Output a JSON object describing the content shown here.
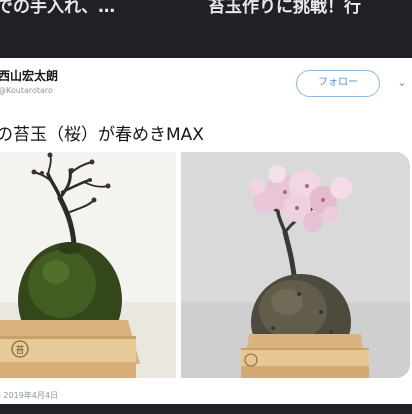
{
  "top_titles": {
    "left": "での手入れ、…",
    "right": "苔玉作りに挑戦！行"
  },
  "tweet": {
    "user_name": "西山宏太朗",
    "handle": "@Koutarotaro",
    "follow_label": "フォロー",
    "text": "の苔玉（桜）が春めきMAX",
    "date": "- 2019年4月4日"
  },
  "icons": {
    "menu": "chevron-down-icon",
    "badge_char": "苔"
  },
  "colors": {
    "background": "#202124",
    "card": "#ffffff",
    "follow_accent": "#4a90d9",
    "moss": "#3f5a1e",
    "wood": "#e8c998",
    "blossom": "#e6bfd3"
  }
}
